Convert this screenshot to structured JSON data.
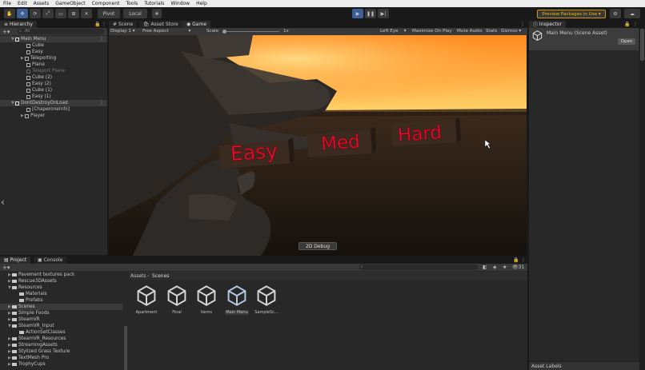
{
  "menubar": [
    "File",
    "Edit",
    "Assets",
    "GameObject",
    "Component",
    "Tools",
    "Tutorials",
    "Window",
    "Help"
  ],
  "toolbar": {
    "pivot": "Pivot",
    "local": "Local",
    "preview_packages": "Preview Packages in Use"
  },
  "hierarchy": {
    "tab": "Hierarchy",
    "search_placeholder": "All",
    "scenes": [
      {
        "name": "Main Menu",
        "children": [
          "Cube",
          "Easy",
          "Teleporting",
          "Plane",
          "Teleport Plane",
          "Cube (2)",
          "Easy (2)",
          "Cube (1)",
          "Easy (1)"
        ]
      },
      {
        "name": "DontDestroyOnLoad",
        "children": [
          "[ChaperoneInfo]",
          "Player"
        ]
      }
    ]
  },
  "center_tabs": [
    "Scene",
    "Asset Store",
    "Game"
  ],
  "game_bar": {
    "display": "Display 1",
    "aspect": "Free Aspect",
    "scale_label": "Scale",
    "scale_value": "1x",
    "eye": "Left Eye",
    "maximize": "Maximize On Play",
    "mute": "Mute Audio",
    "stats": "Stats",
    "gizmos": "Gizmos"
  },
  "game_view": {
    "menu_words": [
      "Easy",
      "Med",
      "Hard"
    ],
    "debug_button": "2D Debug"
  },
  "inspector": {
    "tab": "Inspector",
    "title": "Main Menu (Scene Asset)",
    "open_button": "Open",
    "asset_labels": "Asset Labels"
  },
  "project": {
    "tabs": [
      "Project",
      "Console"
    ],
    "breadcrumb": [
      "Assets",
      "Scenes"
    ],
    "count": "31",
    "tree": [
      {
        "label": "Pavement textures pack",
        "depth": 1
      },
      {
        "label": "Rescue3DAssets",
        "depth": 1
      },
      {
        "label": "Resources",
        "depth": 1
      },
      {
        "label": "Materials",
        "depth": 2
      },
      {
        "label": "Prefabs",
        "depth": 2
      },
      {
        "label": "Scenes",
        "depth": 1
      },
      {
        "label": "Simple Foods",
        "depth": 1
      },
      {
        "label": "SteamVR",
        "depth": 1
      },
      {
        "label": "SteamVR_Input",
        "depth": 1
      },
      {
        "label": "ActionSetClasses",
        "depth": 2
      },
      {
        "label": "SteamVR_Resources",
        "depth": 1
      },
      {
        "label": "StreamingAssets",
        "depth": 1
      },
      {
        "label": "Stylized Grass Texture",
        "depth": 1
      },
      {
        "label": "TextMesh Pro",
        "depth": 1
      },
      {
        "label": "TrophyCups",
        "depth": 1
      }
    ],
    "assets": [
      "Apartment",
      "Final",
      "Items",
      "Main Menu",
      "SampleSc..."
    ]
  },
  "colors": {
    "accent_blue": "#3e5f96",
    "warning_orange": "#f0b400",
    "menu_text_red": "#e8102a"
  }
}
